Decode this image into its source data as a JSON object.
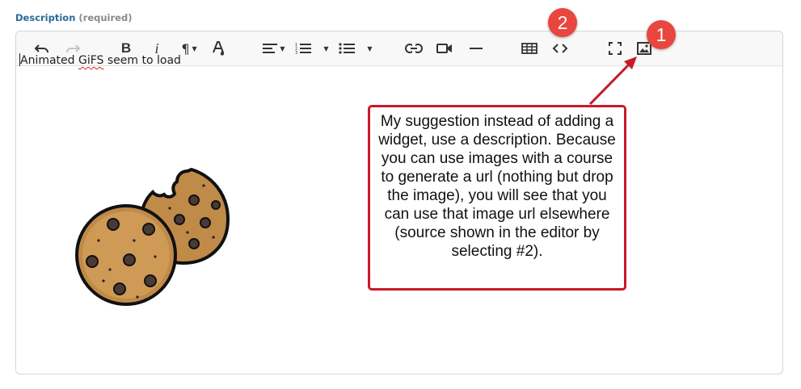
{
  "field": {
    "label": "Description",
    "required": "(required)"
  },
  "toolbar": {
    "bold": "B",
    "italic": "i",
    "paragraph": "¶",
    "font_color": "A"
  },
  "editor": {
    "text_before": "Animated ",
    "text_misspelled": "GiFS",
    "text_after": " seem to load"
  },
  "callout": {
    "text": "My suggestion instead of adding a widget, use a description. Because you can use images with a course to generate a url (nothing but drop the image), you will see that you can use that image url elsewhere (source shown in the editor by selecting #2)."
  },
  "badges": {
    "one": "1",
    "two": "2"
  },
  "colors": {
    "callout_border": "#c8192a",
    "badge": "#e8463e",
    "label": "#2a6a96"
  },
  "icons": [
    "undo-icon",
    "redo-icon",
    "bold-icon",
    "italic-icon",
    "paragraph-icon",
    "font-color-icon",
    "align-icon",
    "ordered-list-icon",
    "unordered-list-icon",
    "link-icon",
    "video-icon",
    "horizontal-rule-icon",
    "table-icon",
    "code-view-icon",
    "fullscreen-icon",
    "image-icon",
    "cookie-image"
  ]
}
